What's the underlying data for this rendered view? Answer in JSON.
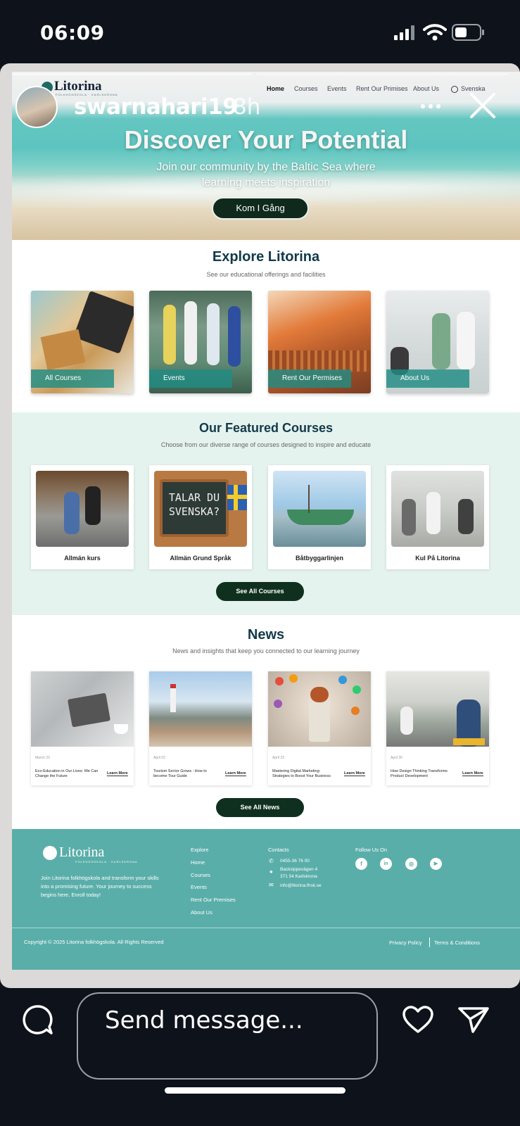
{
  "status_bar": {
    "time": "06:09"
  },
  "story": {
    "username": "swarnahari19",
    "time_ago": "8h",
    "progress_segments": 2
  },
  "site": {
    "logo": "Litorina",
    "logo_sub": "FOLKHÖGSKOLA · KARLSKRONA",
    "nav": [
      "Home",
      "Courses",
      "Events",
      "Rent Our Primises",
      "About Us"
    ],
    "language": "Svenska",
    "hero": {
      "title": "Discover Your Potential",
      "subtitle": "Join our community by the Baltic Sea where learning meets inspiration",
      "cta": "Kom I Gång"
    },
    "explore": {
      "title": "Explore Litorina",
      "subtitle": "See our educational offerings and facilities",
      "cards": [
        "All Courses",
        "Events",
        "Rent Our Permises",
        "About Us"
      ]
    },
    "featured": {
      "title": "Our Featured Courses",
      "subtitle": "Choose from our diverse range of courses designed to inspire and educate",
      "courses": [
        "Allmän kurs",
        "Allmän Grund Språk",
        "Båtbyggarlinjen",
        "Kul På Litorina"
      ],
      "chalkboard_text": "TALAR DU SVENSKA?",
      "button": "See All Courses"
    },
    "news": {
      "title": "News",
      "subtitle": "News and insights that keep you connected to our learning journey",
      "items": [
        {
          "date": "March 23",
          "title": "Eco-Education in Our Lives: We Can Change the Future",
          "more": "Learn More"
        },
        {
          "date": "April 03",
          "title": "Tourism Sector Grows : How to become Tour Guide",
          "more": "Learn More"
        },
        {
          "date": "April 23",
          "title": "Mastering Digital Marketing: Strategies to Boost Your Business",
          "more": "Learn More"
        },
        {
          "date": "April 30",
          "title": "How Design Thinking Transforms Product Development",
          "more": "Learn More"
        }
      ],
      "button": "See All News"
    },
    "footer": {
      "logo": "Litorina",
      "logo_sub": "FOLKHÖGSKOLA · KARLSKRONA",
      "description": "Join Litorina folkhögskola and transform your skills into a promising future. Your journey to success begins here. Enroll today!",
      "explore_heading": "Explore",
      "explore_links": [
        "Home",
        "Courses",
        "Events",
        "Rent Our Premises",
        "About Us"
      ],
      "contacts_heading": "Contacts",
      "phone": "0455-36 76 00",
      "address_line1": "Backsippevägen 4",
      "address_line2": "371 54 Karlskrona",
      "email": "info@litorina.fhsk.se",
      "follow_heading": "Follow Us On",
      "social_icons": [
        "facebook-icon",
        "linkedin-icon",
        "instagram-icon",
        "youtube-icon"
      ],
      "copyright": "Copyright © 2025 Litorina folkhögskola. All Rights Reserved",
      "privacy": "Privacy Policy",
      "terms": "Terms & Conditions"
    }
  },
  "message_bar": {
    "placeholder": "Send message..."
  }
}
